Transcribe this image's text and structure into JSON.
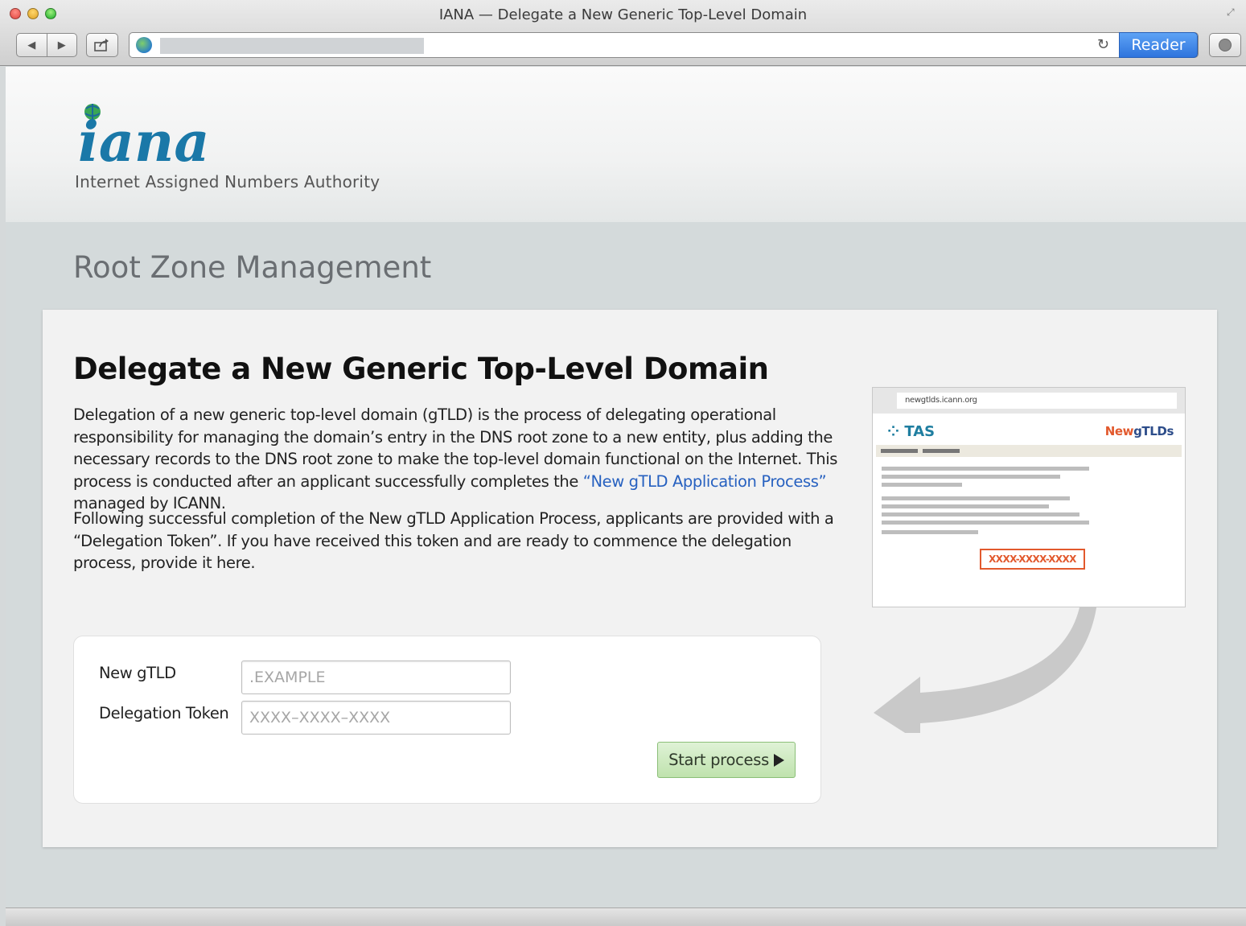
{
  "browser": {
    "window_title": "IANA — Delegate a New Generic Top-Level Domain",
    "reader_label": "Reader",
    "back_icon": "◀",
    "forward_icon": "▶",
    "reload_icon": "↻",
    "share_icon": "share-icon"
  },
  "header": {
    "logo_text": "iana",
    "logo_subtitle": "Internet Assigned Numbers Authority"
  },
  "section_title": "Root Zone Management",
  "card": {
    "title": "Delegate a New Generic Top-Level Domain",
    "para1_before": "Delegation of a new generic top-level domain (gTLD) is the process of delegating operational responsibility for managing the domain’s entry in the DNS root zone to a new entity, plus adding the necessary records to the DNS root zone to make the top-level domain functional on the Internet. This process is conducted after an applicant successfully completes the ",
    "para1_link": "“New gTLD Application Process”",
    "para1_after": " managed by ICANN.",
    "para2": "Following successful completion of the New gTLD Application Process, applicants are provided with a “Delegation Token”. If you have received this token and are ready to commence the delegation process, provide it here."
  },
  "form": {
    "gtld_label": "New gTLD",
    "gtld_placeholder": ".EXAMPLE",
    "gtld_value": "",
    "token_label": "Delegation Token",
    "token_placeholder": "XXXX–XXXX–XXXX",
    "token_value": "",
    "submit_label": "Start process"
  },
  "illustration": {
    "url": "newgtlds.icann.org",
    "tas_label": "TAS",
    "newgtlds_new": "New",
    "newgtlds_gtlds": "gTLDs",
    "token_example": "XXXX-XXXX-XXXX"
  },
  "colors": {
    "link": "#2761c0",
    "button_green": "#bfe2ad",
    "accent_orange": "#e2592d",
    "reader_blue": "#2e74dd"
  }
}
